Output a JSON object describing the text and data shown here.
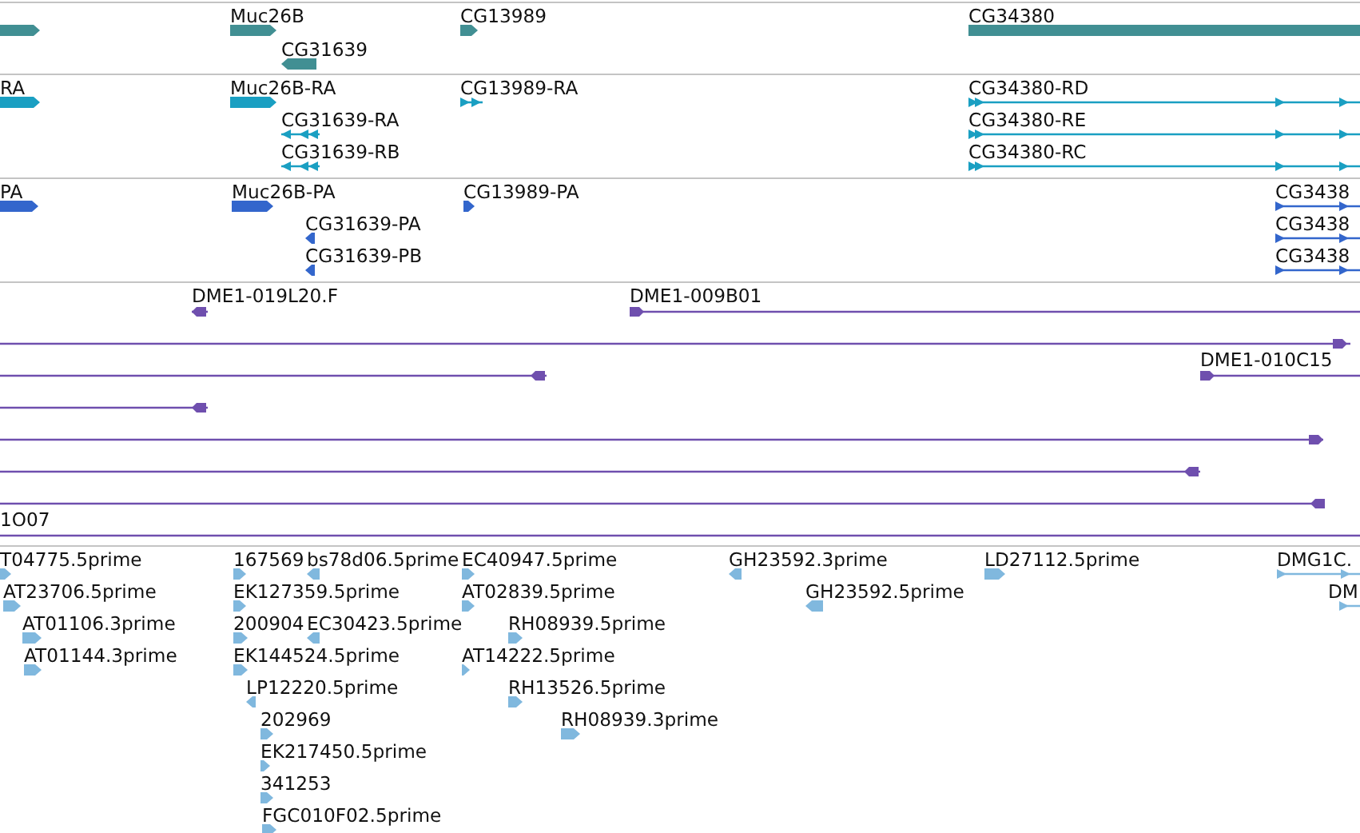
{
  "tracks": [
    {
      "kind": "gene",
      "features": [
        {
          "kind": "block",
          "reverse": false
        },
        {
          "kind": "block",
          "label": "Muc26B",
          "reverse": false
        },
        {
          "kind": "block",
          "label": "CG31639",
          "reverse": true
        },
        {
          "kind": "block",
          "label": "CG13989",
          "reverse": false
        },
        {
          "kind": "block",
          "label": "CG34380"
        }
      ]
    },
    {
      "kind": "mrna",
      "features": [
        {
          "kind": "block",
          "label": "RA",
          "reverse": false
        },
        {
          "kind": "block",
          "label": "Muc26B-RA",
          "reverse": false
        },
        {
          "kind": "transcript",
          "label": "CG31639-RA",
          "reverse": true
        },
        {
          "kind": "transcript",
          "label": "CG31639-RB",
          "reverse": true
        },
        {
          "kind": "transcript",
          "label": "CG13989-RA",
          "reverse": false
        },
        {
          "kind": "transcript",
          "label": "CG34380-RD",
          "reverse": false
        },
        {
          "kind": "transcript",
          "label": "CG34380-RE",
          "reverse": false
        },
        {
          "kind": "transcript",
          "label": "CG34380-RC",
          "reverse": false
        }
      ]
    },
    {
      "kind": "protein",
      "features": [
        {
          "kind": "block",
          "label": "PA",
          "reverse": false
        },
        {
          "kind": "block",
          "label": "Muc26B-PA",
          "reverse": false
        },
        {
          "kind": "block",
          "label": "CG31639-PA",
          "reverse": true
        },
        {
          "kind": "block",
          "label": "CG31639-PB",
          "reverse": true
        },
        {
          "kind": "block",
          "label": "CG13989-PA",
          "reverse": false
        },
        {
          "kind": "transcript",
          "label": "CG3438",
          "reverse": false
        },
        {
          "kind": "transcript",
          "label": "CG3438",
          "reverse": false
        },
        {
          "kind": "transcript",
          "label": "CG3438",
          "reverse": false
        }
      ]
    },
    {
      "kind": "clone",
      "features": [
        {
          "kind": "clone",
          "label": "DME1-019L20.F",
          "reverse": true
        },
        {
          "kind": "clone",
          "label": "DME1-009B01",
          "reverse": false
        },
        {
          "kind": "clone",
          "reverse": false
        },
        {
          "kind": "clone",
          "reverse": true
        },
        {
          "kind": "clone",
          "label": "DME1-010C15",
          "reverse": false
        },
        {
          "kind": "clone",
          "reverse": true
        },
        {
          "kind": "clone",
          "reverse": false
        },
        {
          "kind": "clone",
          "reverse": true
        },
        {
          "kind": "clone",
          "reverse": true
        },
        {
          "kind": "clone",
          "label": "1O07"
        }
      ]
    },
    {
      "kind": "est",
      "features": [
        {
          "kind": "block",
          "label": "T04775.5prime",
          "reverse": false
        },
        {
          "kind": "block",
          "label": "167569",
          "reverse": false
        },
        {
          "kind": "block",
          "label": "bs78d06.5prime",
          "reverse": true
        },
        {
          "kind": "block",
          "label": "EC40947.5prime",
          "reverse": false
        },
        {
          "kind": "block",
          "label": "GH23592.3prime",
          "reverse": true
        },
        {
          "kind": "block",
          "label": "LD27112.5prime",
          "reverse": false
        },
        {
          "kind": "transcript",
          "label": "DMG1C.",
          "reverse": false
        },
        {
          "kind": "block",
          "label": "AT23706.5prime",
          "reverse": false
        },
        {
          "kind": "block",
          "label": "EK127359.5prime",
          "reverse": false
        },
        {
          "kind": "block",
          "label": "AT02839.5prime",
          "reverse": false
        },
        {
          "kind": "block",
          "label": "GH23592.5prime",
          "reverse": true
        },
        {
          "kind": "transcript",
          "label": "DM",
          "reverse": false
        },
        {
          "kind": "block",
          "label": "AT01106.3prime",
          "reverse": false
        },
        {
          "kind": "block",
          "label": "200904",
          "reverse": false
        },
        {
          "kind": "block",
          "label": "EC30423.5prime",
          "reverse": true
        },
        {
          "kind": "block",
          "label": "RH08939.5prime",
          "reverse": false
        },
        {
          "kind": "block",
          "label": "AT01144.3prime",
          "reverse": false
        },
        {
          "kind": "block",
          "label": "EK144524.5prime",
          "reverse": false
        },
        {
          "kind": "block",
          "label": "AT14222.5prime",
          "reverse": false
        },
        {
          "kind": "block",
          "label": "LP12220.5prime",
          "reverse": true
        },
        {
          "kind": "block",
          "label": "RH13526.5prime",
          "reverse": false
        },
        {
          "kind": "block",
          "label": "202969",
          "reverse": false
        },
        {
          "kind": "block",
          "label": "RH08939.3prime",
          "reverse": false
        },
        {
          "kind": "block",
          "label": "EK217450.5prime",
          "reverse": false
        },
        {
          "kind": "block",
          "label": "341253",
          "reverse": false
        },
        {
          "kind": "block",
          "label": "FGC010F02.5prime",
          "reverse": false
        }
      ]
    }
  ]
}
